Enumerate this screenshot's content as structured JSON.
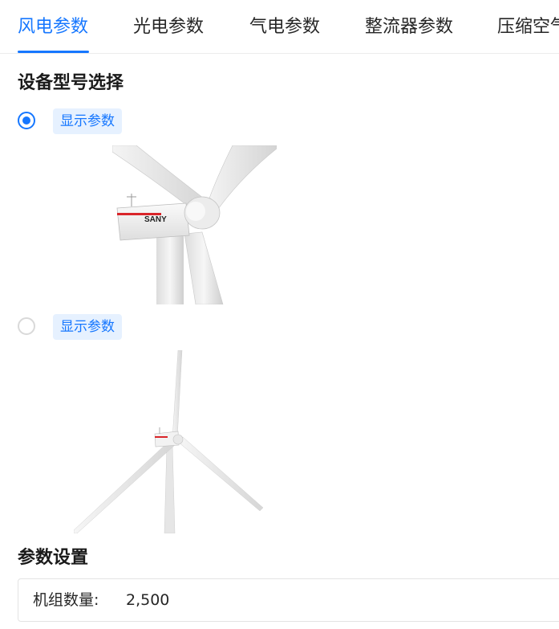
{
  "tabs": [
    {
      "label": "风电参数",
      "active": true
    },
    {
      "label": "光电参数",
      "active": false
    },
    {
      "label": "气电参数",
      "active": false
    },
    {
      "label": "整流器参数",
      "active": false
    },
    {
      "label": "压缩空气",
      "active": false
    }
  ],
  "model_section": {
    "title": "设备型号选择",
    "options": [
      {
        "selected": true,
        "tag": "显示参数",
        "brand": "SANY"
      },
      {
        "selected": false,
        "tag": "显示参数"
      }
    ]
  },
  "params_section": {
    "title": "参数设置",
    "fields": [
      {
        "label": "机组数量:",
        "value": "2,500"
      }
    ]
  },
  "colors": {
    "accent": "#1677ff",
    "tag_bg": "#e6f1ff",
    "brand_red": "#d9252a"
  }
}
